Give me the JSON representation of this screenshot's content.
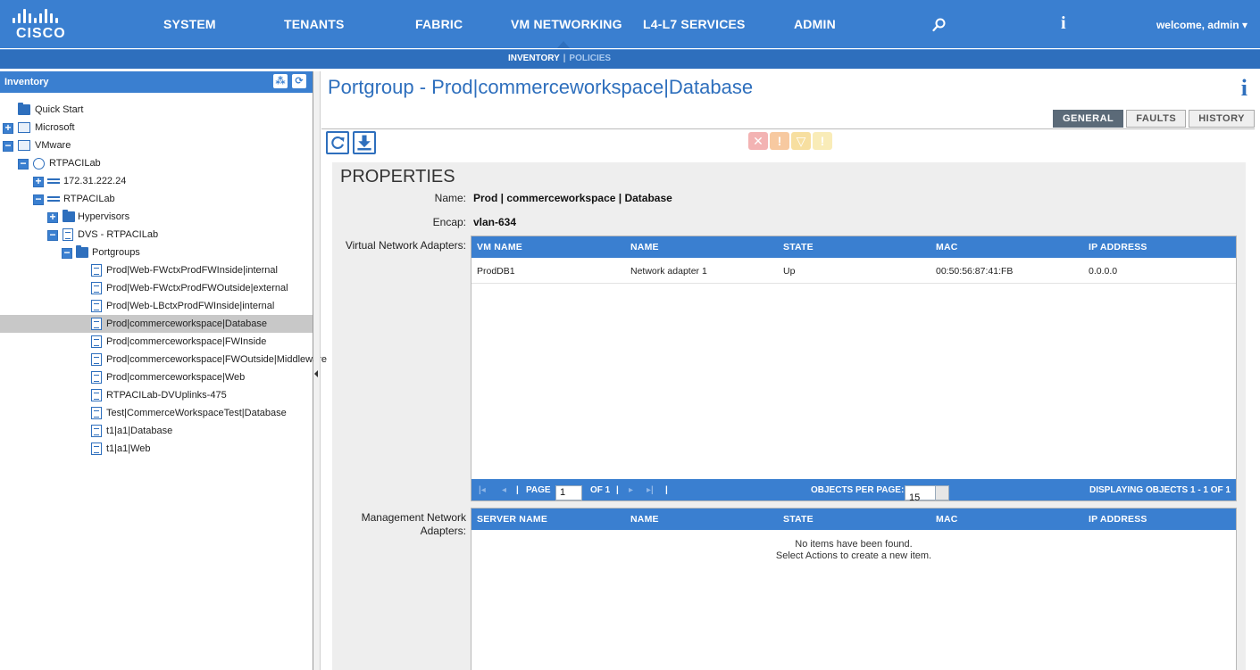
{
  "topnav": {
    "logo_text": "CISCO",
    "items": [
      "SYSTEM",
      "TENANTS",
      "FABRIC",
      "VM NETWORKING",
      "L4-L7 SERVICES",
      "ADMIN"
    ],
    "active": "VM NETWORKING",
    "info_label": "i",
    "welcome": "welcome, admin ▾"
  },
  "subnav": {
    "inventory": "INVENTORY",
    "separator": "|",
    "policies": "POLICIES"
  },
  "inventory": {
    "title": "Inventory",
    "nodes": [
      {
        "label": "Quick Start",
        "icon": "folder-icon"
      },
      {
        "label": "Microsoft",
        "icon": "vmm-domain-icon",
        "expander": "+"
      },
      {
        "label": "VMware",
        "icon": "vmm-domain-icon",
        "expander": "−"
      },
      {
        "label": "RTPACILab",
        "icon": "globe-icon",
        "expander": "−"
      },
      {
        "label": "172.31.222.24",
        "icon": "controller-icon",
        "expander": "+"
      },
      {
        "label": "RTPACILab",
        "icon": "controller-icon",
        "expander": "−"
      },
      {
        "label": "Hypervisors",
        "icon": "folder-icon",
        "expander": "+"
      },
      {
        "label": "DVS - RTPACILab",
        "icon": "document-icon",
        "expander": "−"
      },
      {
        "label": "Portgroups",
        "icon": "folder-icon",
        "expander": "−"
      },
      {
        "label": "Prod|Web-FWctxProdFWInside|internal",
        "icon": "document-icon"
      },
      {
        "label": "Prod|Web-FWctxProdFWOutside|external",
        "icon": "document-icon"
      },
      {
        "label": "Prod|Web-LBctxProdFWInside|internal",
        "icon": "document-icon"
      },
      {
        "label": "Prod|commerceworkspace|Database",
        "icon": "document-icon",
        "selected": true
      },
      {
        "label": "Prod|commerceworkspace|FWInside",
        "icon": "document-icon"
      },
      {
        "label": "Prod|commerceworkspace|FWOutside|Middleware",
        "icon": "document-icon"
      },
      {
        "label": "Prod|commerceworkspace|Web",
        "icon": "document-icon"
      },
      {
        "label": "RTPACILab-DVUplinks-475",
        "icon": "document-icon"
      },
      {
        "label": "Test|CommerceWorkspaceTest|Database",
        "icon": "document-icon"
      },
      {
        "label": "t1|a1|Database",
        "icon": "document-icon"
      },
      {
        "label": "t1|a1|Web",
        "icon": "document-icon"
      }
    ]
  },
  "page": {
    "title": "Portgroup - Prod|commerceworkspace|Database",
    "info": "i",
    "tabs": [
      "GENERAL",
      "FAULTS",
      "HISTORY"
    ],
    "active_tab": "GENERAL",
    "fault_colors": [
      "#f3b3b3",
      "#f7c9a0",
      "#f7dfa0",
      "#f9ecb8"
    ]
  },
  "properties": {
    "title": "PROPERTIES",
    "name_label": "Name:",
    "name_value": "Prod | commerceworkspace | Database",
    "encap_label": "Encap:",
    "encap_value": "vlan-634",
    "vna_label": "Virtual Network Adapters:",
    "vna_columns": [
      "VM NAME",
      "NAME",
      "STATE",
      "MAC",
      "IP ADDRESS"
    ],
    "vna_rows": [
      [
        "ProdDB1",
        "Network adapter 1",
        "Up",
        "00:50:56:87:41:FB",
        "0.0.0.0"
      ]
    ],
    "pager": {
      "page_label": "PAGE",
      "page_value": "1",
      "of_label": "OF 1",
      "opp_label": "OBJECTS PER PAGE:",
      "opp_value": "15",
      "displaying": "DISPLAYING OBJECTS 1 - 1 OF 1"
    },
    "mna_label_1": "Management Network",
    "mna_label_2": "Adapters:",
    "mna_columns": [
      "SERVER NAME",
      "NAME",
      "STATE",
      "MAC",
      "IP ADDRESS"
    ],
    "mna_empty_1": "No items have been found.",
    "mna_empty_2": "Select Actions to create a new item."
  }
}
